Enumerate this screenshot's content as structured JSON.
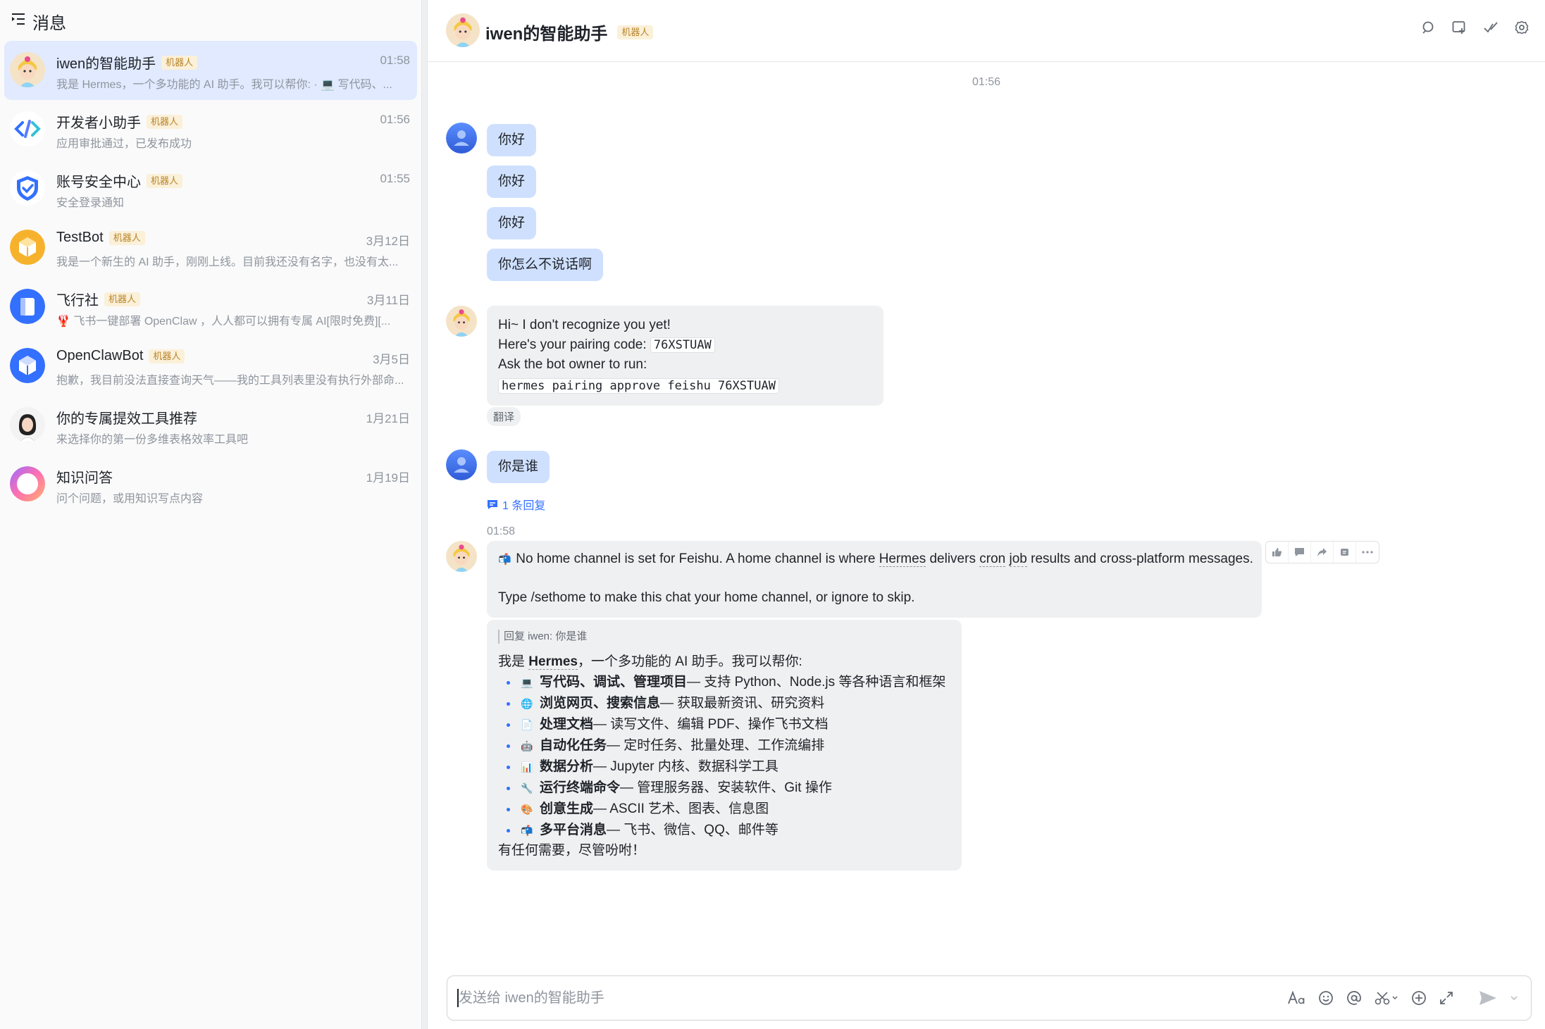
{
  "sidebar": {
    "title": "消息",
    "conversations": [
      {
        "name": "iwen的智能助手",
        "tag": "机器人",
        "time": "01:58",
        "preview": "我是 Hermes，一个多功能的 AI 助手。我可以帮你: · 💻 写代码、...",
        "active": true
      },
      {
        "name": "开发者小助手",
        "tag": "机器人",
        "time": "01:56",
        "preview": "应用审批通过，已发布成功"
      },
      {
        "name": "账号安全中心",
        "tag": "机器人",
        "time": "01:55",
        "preview": "安全登录通知"
      },
      {
        "name": "TestBot",
        "tag": "机器人",
        "time": "3月12日",
        "preview": "我是一个新生的 AI 助手，刚刚上线。目前我还没有名字，也没有太..."
      },
      {
        "name": "飞行社",
        "tag": "机器人",
        "time": "3月11日",
        "preview": "🦞 飞书一键部署 OpenClaw ，人人都可以拥有专属 AI[限时免费][..."
      },
      {
        "name": "OpenClawBot",
        "tag": "机器人",
        "time": "3月5日",
        "preview": "抱歉，我目前没法直接查询天气——我的工具列表里没有执行外部命..."
      },
      {
        "name": "你的专属提效工具推荐",
        "tag": "",
        "time": "1月21日",
        "preview": "来选择你的第一份多维表格效率工具吧"
      },
      {
        "name": "知识问答",
        "tag": "",
        "time": "1月19日",
        "preview": "问个问题，或用知识写点内容"
      }
    ]
  },
  "chat": {
    "title": "iwen的智能助手",
    "tag": "机器人",
    "time_divider": "01:56",
    "user_msgs": [
      "你好",
      "你好",
      "你好",
      "你怎么不说话啊"
    ],
    "pairing": {
      "line1": "Hi~ I don't recognize you yet!",
      "line2_prefix": "Here's your pairing code:",
      "code": "76XSTUAW",
      "line3": "Ask the bot owner to run:",
      "command": "hermes pairing approve feishu 76XSTUAW"
    },
    "translate": "翻译",
    "user_who": "你是谁",
    "reply_count": "1 条回复",
    "time2": "01:58",
    "home_channel": {
      "pre": "No home channel is set for Feishu. A home channel is where",
      "w1": "Hermes",
      "mid1": "delivers",
      "w2": "cron",
      "w3": "job",
      "post": "results and cross-platform messages.",
      "line2": "Type /sethome to make this chat your home channel, or ignore to skip."
    },
    "reply": {
      "quote": "回复 iwen:  你是谁",
      "intro_pre": "我是 ",
      "intro_name": "Hermes",
      "intro_post": "，一个多功能的 AI 助手。我可以帮你:",
      "items": [
        {
          "emoji": "💻",
          "bold": "写代码、调试、管理项目",
          "rest": " — 支持 Python、Node.js 等各种语言和框架"
        },
        {
          "emoji": "🌐",
          "bold": "浏览网页、搜索信息",
          "rest": " — 获取最新资讯、研究资料"
        },
        {
          "emoji": "📄",
          "bold": "处理文档",
          "rest": " — 读写文件、编辑 PDF、操作飞书文档"
        },
        {
          "emoji": "🤖",
          "bold": "自动化任务",
          "rest": " — 定时任务、批量处理、工作流编排"
        },
        {
          "emoji": "📊",
          "bold": "数据分析",
          "rest": " — Jupyter 内核、数据科学工具"
        },
        {
          "emoji": "🔧",
          "bold": "运行终端命令",
          "rest": " — 管理服务器、安装软件、Git 操作"
        },
        {
          "emoji": "🎨",
          "bold": "创意生成",
          "rest": " — ASCII 艺术、图表、信息图"
        },
        {
          "emoji": "📬",
          "bold": "多平台消息",
          "rest": " — 飞书、微信、QQ、邮件等"
        }
      ],
      "outro": "有任何需要，尽管吩咐！"
    }
  },
  "composer": {
    "placeholder": "发送给 iwen的智能助手"
  },
  "colors": {
    "accent": "#3370ff",
    "user_bubble": "#cfe0ff",
    "bot_bubble": "#eff0f1",
    "active_conv": "#e1eaff",
    "bot_tag_bg": "#fbf0d8",
    "bot_tag_text": "#b8842a"
  }
}
